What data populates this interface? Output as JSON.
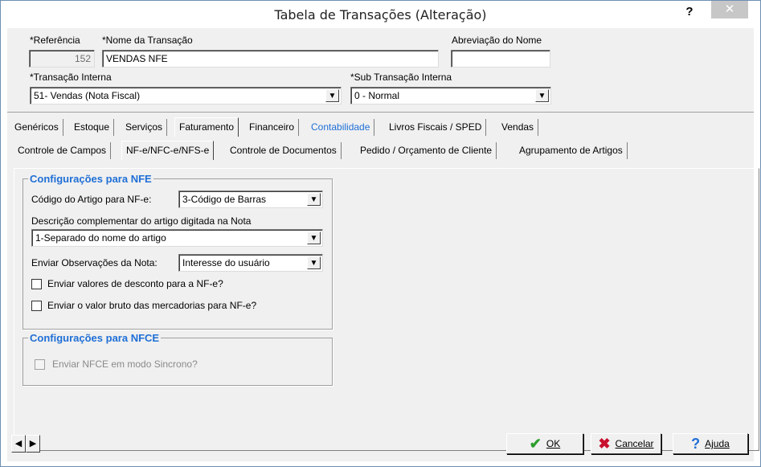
{
  "window": {
    "title": "Tabela de Transações (Alteração)",
    "help_label": "?",
    "close_label": "✕"
  },
  "form": {
    "referencia_label": "*Referência",
    "referencia_value": "152",
    "nome_label": "*Nome da Transação",
    "nome_value": "VENDAS NFE",
    "abreviacao_label": "Abreviação do Nome",
    "abreviacao_value": "",
    "transacao_interna_label": "*Transação Interna",
    "transacao_interna_value": "51- Vendas (Nota Fiscal)",
    "sub_transacao_label": "*Sub Transação Interna",
    "sub_transacao_value": "0 - Normal"
  },
  "main_tabs": [
    "Genéricos",
    "Estoque",
    "Serviços",
    "Faturamento",
    "Financeiro",
    "Contabilidade",
    "Livros Fiscais / SPED",
    "Vendas"
  ],
  "sub_tabs": [
    "Controle de Campos",
    "NF-e/NFC-e/NFS-e",
    "Controle de Documentos",
    "Pedido / Orçamento de Cliente",
    "Agrupamento de Artigos"
  ],
  "nfe_group": {
    "title": "Configurações para NFE",
    "codigo_label": "Código do Artigo para NF-e:",
    "codigo_value": "3-Código de Barras",
    "descricao_label": "Descrição complementar do artigo digitada na Nota",
    "descricao_value": "1-Separado do nome do artigo",
    "obs_label": "Enviar Observações da Nota:",
    "obs_value": "Interesse do usuário",
    "desconto_label": "Enviar valores de desconto para a NF-e?",
    "bruto_label": "Enviar o valor bruto das mercadorias para NF-e?"
  },
  "nfce_group": {
    "title": "Configurações para NFCE",
    "sincrono_label": "Enviar NFCE em modo Sincrono?"
  },
  "footer": {
    "ok_label": "OK",
    "cancel_label": "Cancelar",
    "help_label": "Ajuda"
  },
  "colors": {
    "accent": "#1f6fd6",
    "ok_green": "#2e9d2e",
    "cancel_red": "#c8102e"
  }
}
